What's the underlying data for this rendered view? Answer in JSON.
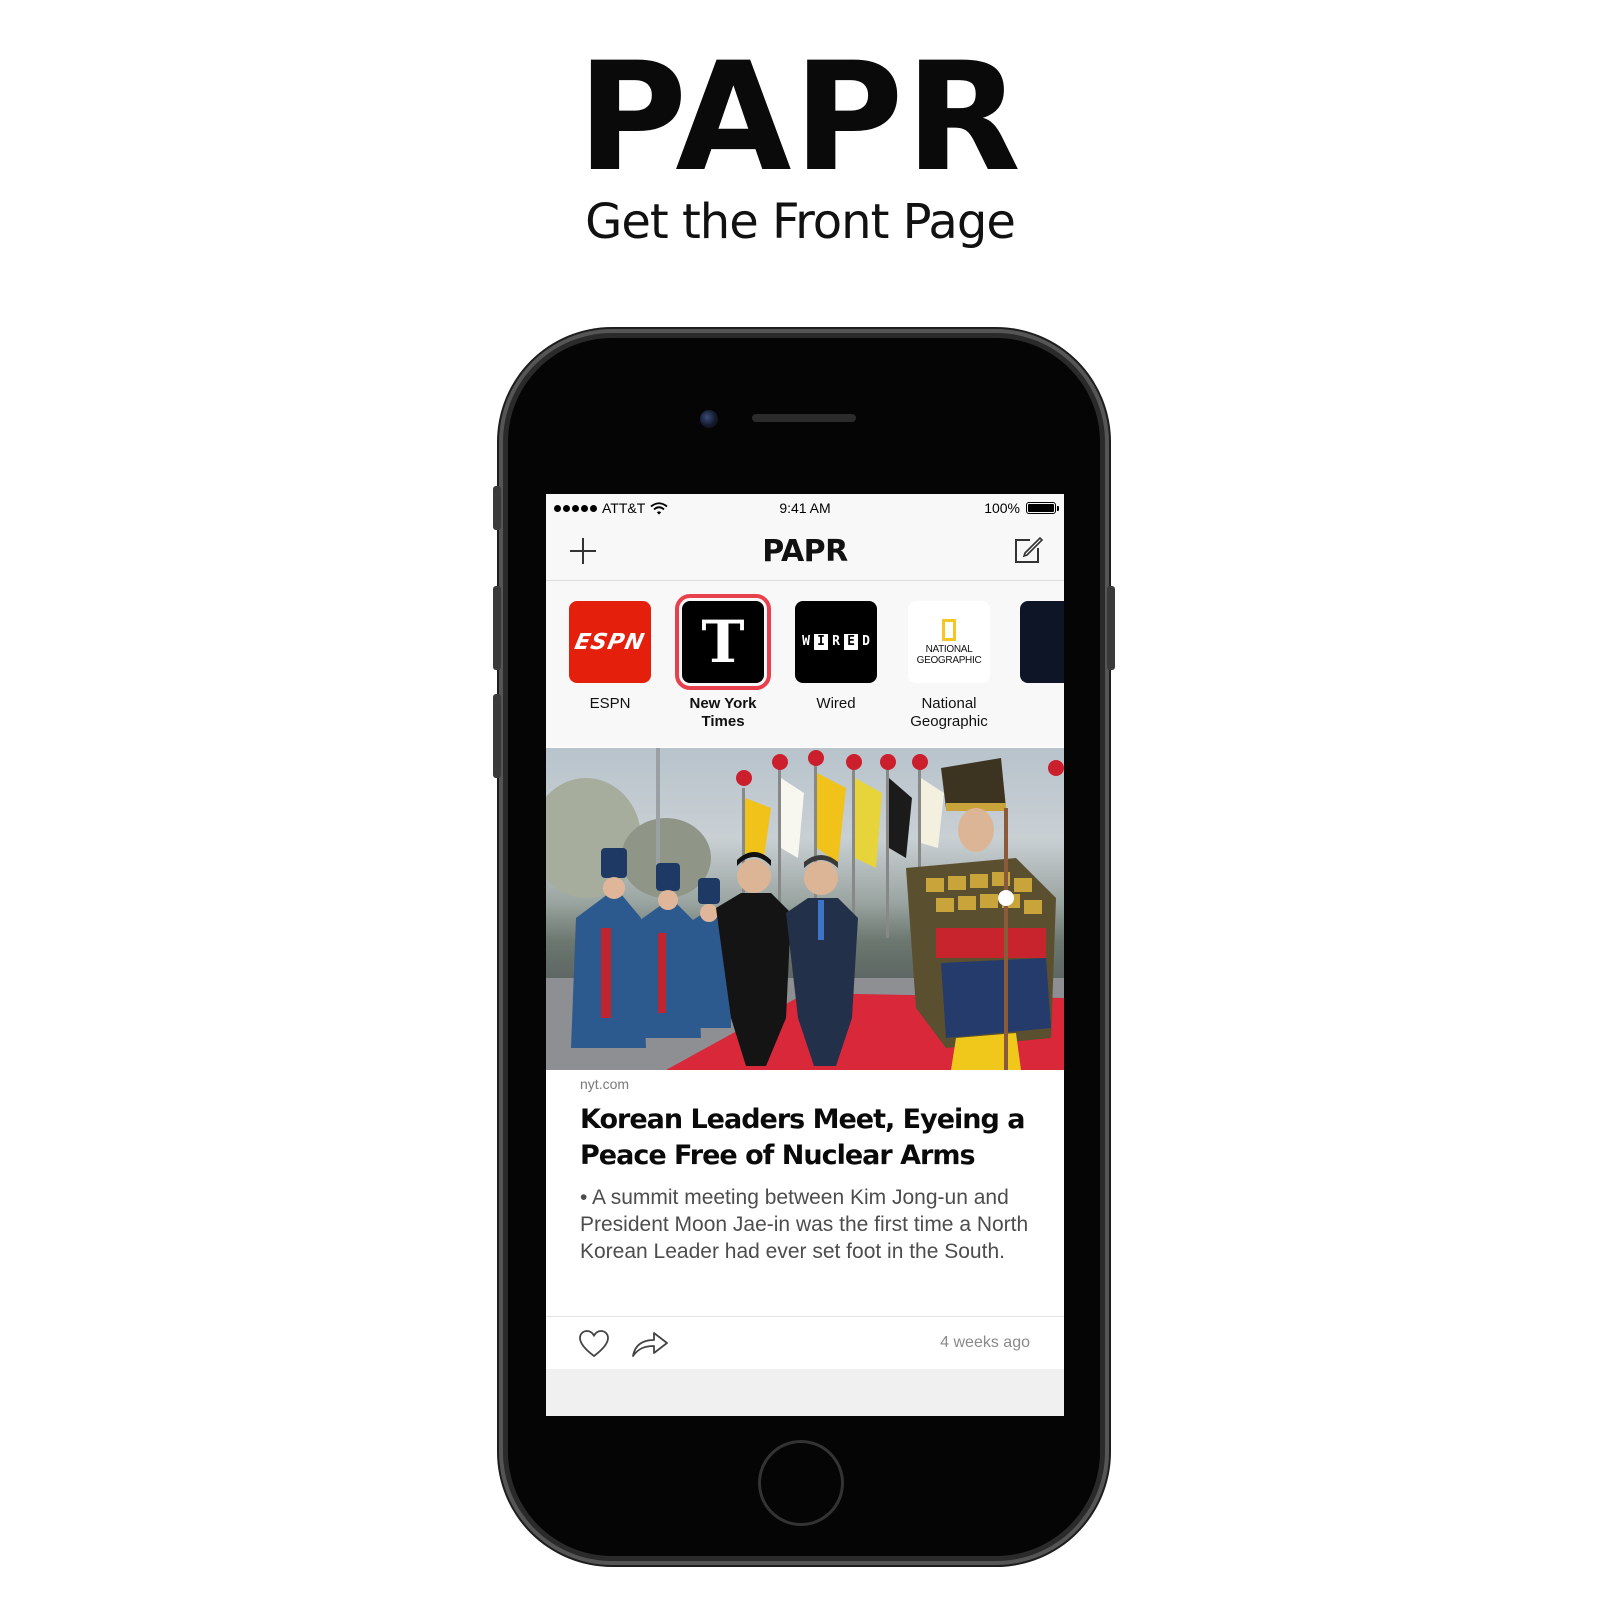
{
  "promo": {
    "title": "PAPR",
    "subtitle": "Get the Front Page"
  },
  "status_bar": {
    "carrier": "ATT&T",
    "time": "9:41 AM",
    "battery": "100%",
    "battery_level": 1.0
  },
  "nav": {
    "title": "PAPR",
    "left_icon": "plus-icon",
    "right_icon": "compose-icon"
  },
  "sources": [
    {
      "label": "ESPN",
      "logo_text": "ESPN",
      "selected": false
    },
    {
      "label": "New York Times",
      "logo_text": "T",
      "selected": true
    },
    {
      "label": "Wired",
      "logo_letters": [
        "W",
        "I",
        "R",
        "E",
        "D"
      ],
      "selected": false
    },
    {
      "label": "National Geographic",
      "logo_text": "NATIONAL GEOGRAPHIC",
      "selected": false
    }
  ],
  "article": {
    "domain": "nyt.com",
    "headline": "Korean Leaders Meet, Eyeing a Peace Free of Nuclear Arms",
    "summary": "• A summit meeting between Kim Jong-un and President Moon Jae-in was the first time a North Korean Leader had ever set foot in the South.",
    "timestamp": "4 weeks ago",
    "actions": [
      "heart-icon",
      "share-icon"
    ]
  },
  "colors": {
    "selected_outline": "#e8404d",
    "espn_red": "#e4200d",
    "natgeo_yellow": "#f6c624",
    "carpet_red": "#d8283a"
  }
}
